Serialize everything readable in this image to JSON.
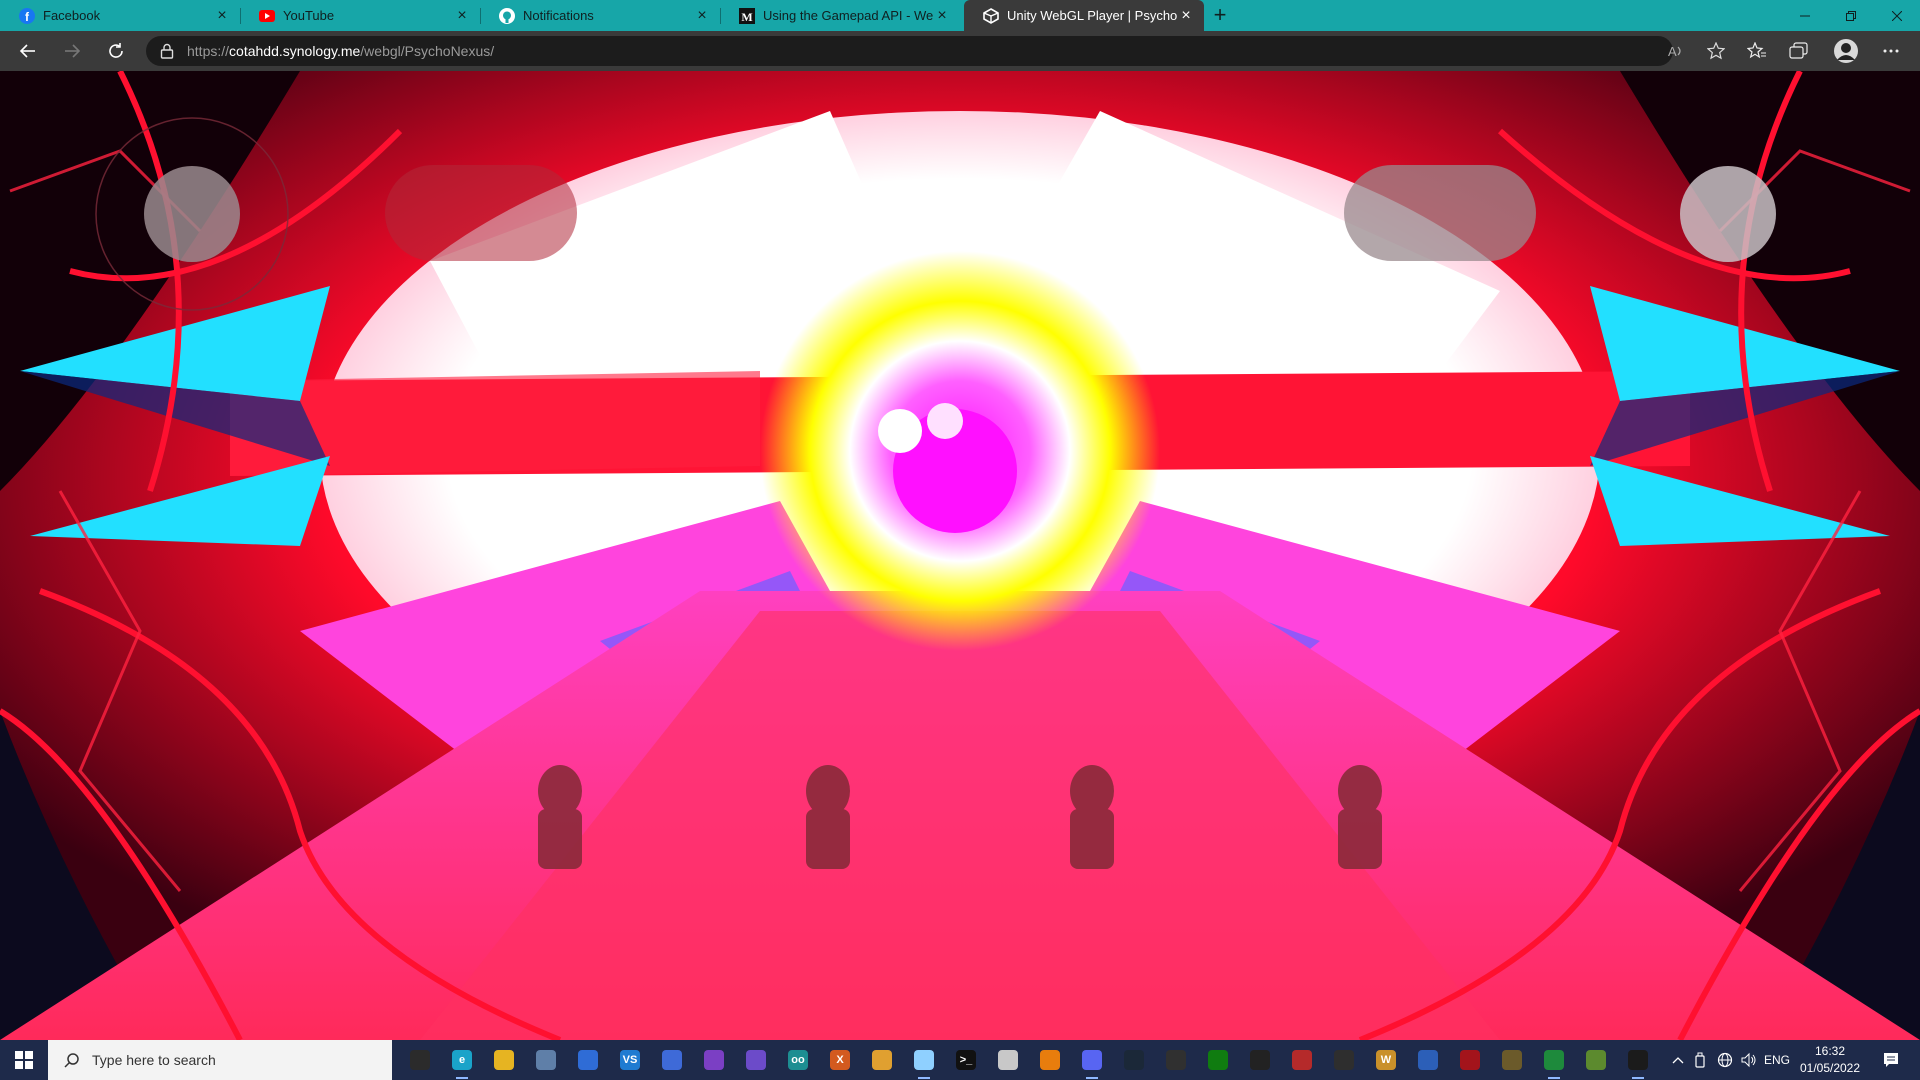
{
  "browser": {
    "tabs": [
      {
        "title": "Facebook",
        "icon": "facebook-icon",
        "active": false
      },
      {
        "title": "YouTube",
        "icon": "youtube-icon",
        "active": false
      },
      {
        "title": "Notifications",
        "icon": "github-icon",
        "active": false
      },
      {
        "title": "Using the Gamepad API - Web A",
        "icon": "mdn-icon",
        "active": false
      },
      {
        "title": "Unity WebGL Player | PsychoNex",
        "icon": "unity-icon",
        "active": true
      }
    ],
    "new_tab": "+",
    "url_prefix": "https://",
    "url_host": "cotahdd.synology.me",
    "url_path": "/webgl/PsychoNexus/",
    "accent": "#17a6a8"
  },
  "taskbar": {
    "search_placeholder": "Type here to search",
    "language": "ENG",
    "time": "16:32",
    "date": "01/05/2022",
    "apps": [
      {
        "name": "task-view-icon",
        "color": "#2b2b2b",
        "glyph": "",
        "running": false
      },
      {
        "name": "edge-icon",
        "color": "#1aa3c9",
        "glyph": "e",
        "running": true
      },
      {
        "name": "file-explorer-icon",
        "color": "#e6b422",
        "glyph": "",
        "running": false
      },
      {
        "name": "printer-app-icon",
        "color": "#5f7fa8",
        "glyph": "",
        "running": false
      },
      {
        "name": "network-app-icon",
        "color": "#2f6cd6",
        "glyph": "",
        "running": false
      },
      {
        "name": "vs-code-icon",
        "color": "#1f7bd1",
        "glyph": "VS",
        "running": false
      },
      {
        "name": "windows-app-icon",
        "color": "#3e6ad8",
        "glyph": "",
        "running": false
      },
      {
        "name": "visual-studio-icon",
        "color": "#7b3fc4",
        "glyph": "",
        "running": false
      },
      {
        "name": "github-desktop-icon",
        "color": "#6c4bc9",
        "glyph": "",
        "running": false
      },
      {
        "name": "arduino-icon",
        "color": "#1d8e92",
        "glyph": "oo",
        "running": false
      },
      {
        "name": "xampp-icon",
        "color": "#d35a1f",
        "glyph": "X",
        "running": false
      },
      {
        "name": "paint-icon",
        "color": "#e0a030",
        "glyph": "",
        "running": false
      },
      {
        "name": "notepad-icon",
        "color": "#8fd0ff",
        "glyph": "",
        "running": true
      },
      {
        "name": "terminal-icon",
        "color": "#111111",
        "glyph": ">_",
        "running": false
      },
      {
        "name": "document-icon",
        "color": "#c8c8c8",
        "glyph": "",
        "running": false
      },
      {
        "name": "blender-icon",
        "color": "#e87d0d",
        "glyph": "",
        "running": false
      },
      {
        "name": "discord-icon",
        "color": "#5865f2",
        "glyph": "",
        "running": true
      },
      {
        "name": "steam-icon",
        "color": "#1b2838",
        "glyph": "",
        "running": false
      },
      {
        "name": "obs-icon",
        "color": "#303030",
        "glyph": "",
        "running": false
      },
      {
        "name": "xbox-icon",
        "color": "#107c10",
        "glyph": "",
        "running": false
      },
      {
        "name": "unity-hub-icon",
        "color": "#222222",
        "glyph": "",
        "running": false
      },
      {
        "name": "hardware-app-icon",
        "color": "#b52a2a",
        "glyph": "",
        "running": false
      },
      {
        "name": "game-app-icon",
        "color": "#2e2e2e",
        "glyph": "",
        "running": false
      },
      {
        "name": "warcraft-icon",
        "color": "#c9902a",
        "glyph": "W",
        "running": false
      },
      {
        "name": "battlenet-icon",
        "color": "#2c5fb8",
        "glyph": "",
        "running": false
      },
      {
        "name": "red-app-icon",
        "color": "#a3141b",
        "glyph": "",
        "running": false
      },
      {
        "name": "game-art-icon",
        "color": "#6b5a2a",
        "glyph": "",
        "running": false
      },
      {
        "name": "green-app-icon",
        "color": "#1e8a3c",
        "glyph": "",
        "running": true
      },
      {
        "name": "minecraft-icon",
        "color": "#5c8a2e",
        "glyph": "",
        "running": false
      },
      {
        "name": "unity-editor-icon",
        "color": "#1b1b1b",
        "glyph": "",
        "running": true
      }
    ]
  }
}
